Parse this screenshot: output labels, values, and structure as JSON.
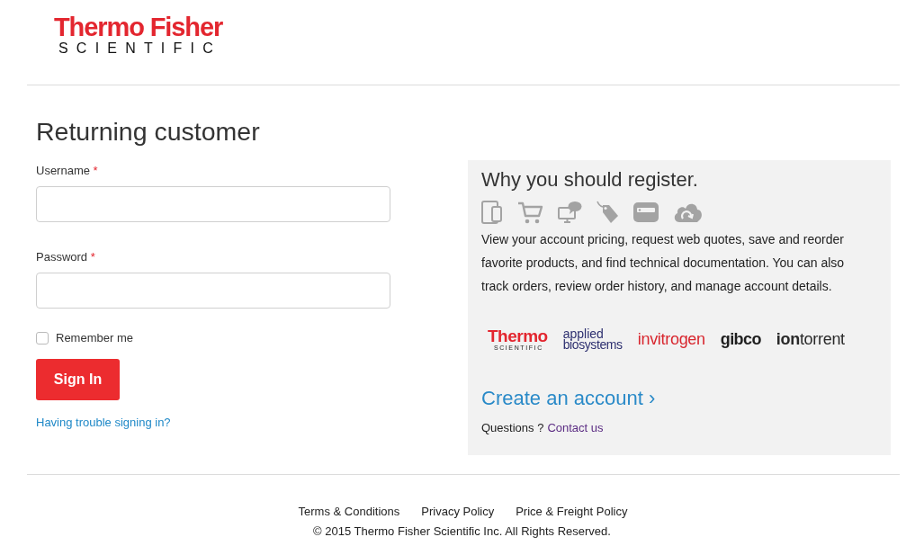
{
  "logo": {
    "wordmark": "Thermo Fisher",
    "tagline": "SCIENTIFIC"
  },
  "login": {
    "title": "Returning customer",
    "fields": [
      {
        "label": "Username",
        "required_mark": "*"
      },
      {
        "label": "Password",
        "required_mark": "*"
      }
    ],
    "remember": {
      "label": "Remember me",
      "checked": false
    },
    "submit": "Sign In",
    "help_link": "Having trouble signing in?"
  },
  "register": {
    "title": "Why you should register.",
    "text": "View your account pricing, request web quotes, save and reorder favorite products, and find technical documentation. You can also track orders, review order history, and manage account details.",
    "brands": [
      {
        "kind": "tagline",
        "text": "Thermo",
        "sub": "SCIENTIFIC",
        "color": "#e3262f"
      },
      {
        "kind": "two-line",
        "text": "applied",
        "sub": "biosystems",
        "color": "#2e3070"
      },
      {
        "kind": "word",
        "text": "invitrogen",
        "color": "#d8262e"
      },
      {
        "kind": "bold-word",
        "text": "gibco",
        "color": "#1f1f1f"
      },
      {
        "kind": "word",
        "text": "**ion**torrent",
        "color": "#2a2a2a"
      }
    ],
    "create_link": "Create an account ›",
    "questions": "Questions ?",
    "contact_link": "Contact us"
  },
  "footer": {
    "links": [
      "Terms & Conditions",
      "Privacy Policy",
      "Price & Freight Policy"
    ],
    "copyright": "© 2015 Thermo Fisher Scientific Inc. All Rights Reserved."
  }
}
